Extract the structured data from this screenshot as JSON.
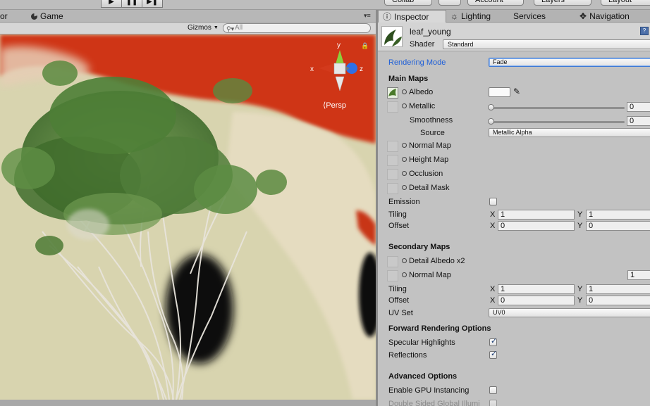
{
  "top_toolbar": {
    "play_icon": "play-icon",
    "pause_icon": "pause-icon",
    "step_icon": "step-icon",
    "collab": "Collab",
    "account": "Account",
    "layers": "Layers",
    "layout": "Layout"
  },
  "game_panel": {
    "tab_partial": "or",
    "tab_game": "Game",
    "gizmos": "Gizmos",
    "search_placeholder": "All",
    "persp_label": "Persp",
    "axis_x": "x",
    "axis_y": "y",
    "axis_z": "z"
  },
  "inspector_tabs": [
    {
      "label": "Inspector",
      "icon": "info-icon"
    },
    {
      "label": "Lighting",
      "icon": "lighting-icon"
    },
    {
      "label": "Services",
      "icon": ""
    },
    {
      "label": "Navigation",
      "icon": "navigation-icon"
    }
  ],
  "asset": {
    "name": "leaf_young",
    "shader_label": "Shader",
    "shader_value": "Standard"
  },
  "material": {
    "rendering_mode_label": "Rendering Mode",
    "rendering_mode_value": "Fade",
    "main_maps": "Main Maps",
    "albedo": "Albedo",
    "metallic": "Metallic",
    "metallic_value": "0",
    "smoothness": "Smoothness",
    "smoothness_value": "0",
    "source_label": "Source",
    "source_value": "Metallic Alpha",
    "normal_map": "Normal Map",
    "height_map": "Height Map",
    "occlusion": "Occlusion",
    "detail_mask": "Detail Mask",
    "emission": "Emission",
    "tiling": "Tiling",
    "offset": "Offset",
    "x": "X",
    "y": "Y",
    "main_tiling_x": "1",
    "main_tiling_y": "1",
    "main_offset_x": "0",
    "main_offset_y": "0",
    "secondary_maps": "Secondary Maps",
    "detail_albedo": "Detail Albedo x2",
    "secondary_normal_map": "Normal Map",
    "secondary_normal_value": "1",
    "sec_tiling_x": "1",
    "sec_tiling_y": "1",
    "sec_offset_x": "0",
    "sec_offset_y": "0",
    "uv_set_label": "UV Set",
    "uv_set_value": "UV0",
    "forward_rendering": "Forward Rendering Options",
    "specular_highlights": "Specular Highlights",
    "reflections": "Reflections",
    "advanced_options": "Advanced Options",
    "gpu_instancing": "Enable GPU Instancing",
    "double_sided": "Double Sided Global Illumi"
  },
  "colors": {
    "accent_blue": "#1e5fd8",
    "panel_bg": "#c2c2c2",
    "sky_red": "#cc3312"
  }
}
